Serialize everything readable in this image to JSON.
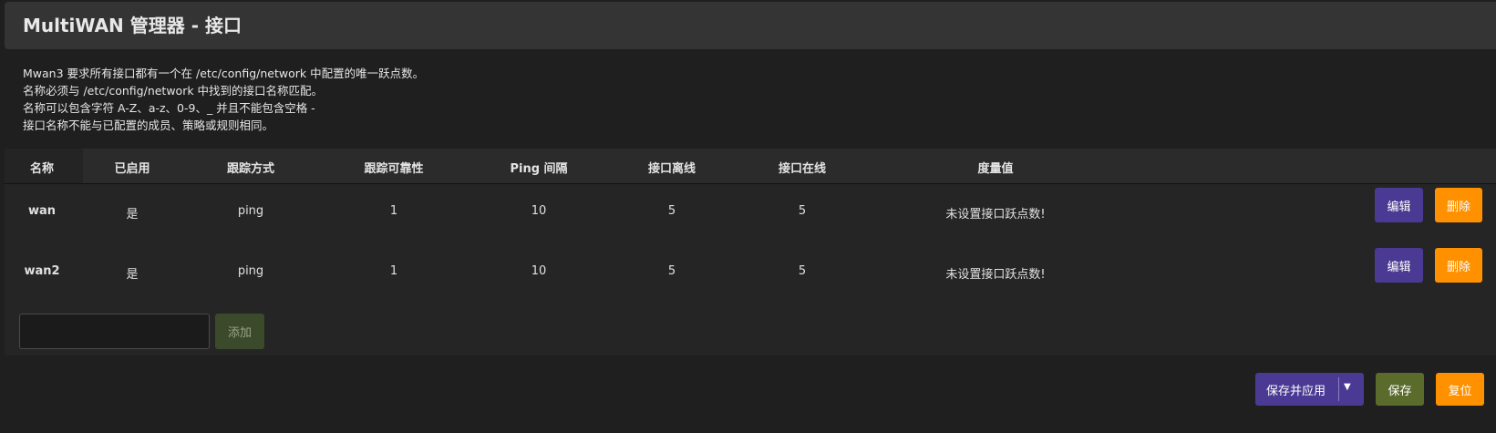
{
  "page_title": "MultiWAN 管理器 - 接口",
  "description": [
    "Mwan3 要求所有接口都有一个在 /etc/config/network 中配置的唯一跃点数。",
    "名称必须与 /etc/config/network 中找到的接口名称匹配。",
    "名称可以包含字符 A-Z、a-z、0-9、_ 并且不能包含空格 -",
    "接口名称不能与已配置的成员、策略或规则相同。"
  ],
  "table": {
    "headers": [
      "名称",
      "已启用",
      "跟踪方式",
      "跟踪可靠性",
      "Ping 间隔",
      "接口离线",
      "接口在线",
      "度量值"
    ],
    "rows": [
      {
        "name": "wan",
        "enabled": "是",
        "track_method": "ping",
        "reliability": "1",
        "ping_interval": "10",
        "down": "5",
        "up": "5",
        "metric": "未设置接口跃点数!",
        "edit_label": "编辑",
        "delete_label": "删除"
      },
      {
        "name": "wan2",
        "enabled": "是",
        "track_method": "ping",
        "reliability": "1",
        "ping_interval": "10",
        "down": "5",
        "up": "5",
        "metric": "未设置接口跃点数!",
        "edit_label": "编辑",
        "delete_label": "删除"
      }
    ]
  },
  "add_section": {
    "input_value": "",
    "add_label": "添加"
  },
  "footer": {
    "save_apply_label": "保存并应用",
    "save_label": "保存",
    "reset_label": "复位",
    "dropdown_icon": "caret-down-icon"
  },
  "colors": {
    "background": "#1f1f1f",
    "edit_button": "#4a3a93",
    "delete_button": "#ff9100",
    "save_button": "#5b6b2c",
    "reset_button": "#ff9100",
    "add_button": "#3b4a2a"
  }
}
